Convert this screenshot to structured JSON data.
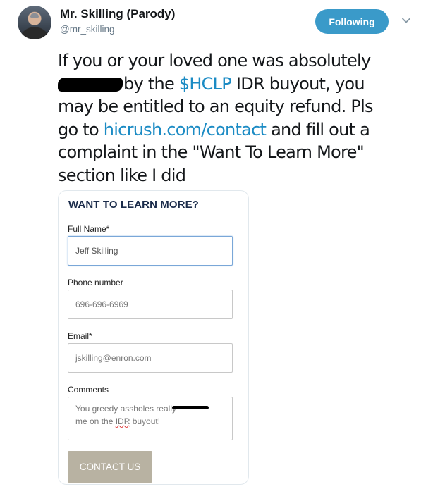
{
  "tweet": {
    "display_name": "Mr. Skilling (Parody)",
    "handle": "@mr_skilling",
    "follow_button": "Following",
    "text": {
      "line1": "If you or your loved one was absolutely",
      "line2_after_redaction": "by the ",
      "line2_cashtag": "$HCLP",
      "line2_end": " IDR buyout, you",
      "line3": "may be entitled to an equity refund. Pls",
      "line4_start": "go to ",
      "line4_link": "hicrush.com/contact",
      "line4_end": " and fill out a",
      "line5": "complaint in the \"Want To Learn More\"",
      "line6": "section like I did"
    },
    "icons": [
      "avatar",
      "chevron-down-icon",
      "redaction-mark"
    ]
  },
  "form": {
    "title": "WANT TO LEARN MORE?",
    "full_name_label": "Full Name*",
    "full_name_value": "Jeff Skilling",
    "phone_label": "Phone number",
    "phone_value": "696-696-6969",
    "email_label": "Email*",
    "email_value": "jskilling@enron.com",
    "comments_label": "Comments",
    "comments_line1": "You greedy assholes really",
    "comments_line2_start": "me on the ",
    "comments_line2_idr": "IDR",
    "comments_line2_end": " buyout!",
    "submit_label": "CONTACT US"
  },
  "colors": {
    "follow_button": "#3a9ac9",
    "link": "#1b8bc4",
    "submit_button": "#b8b2a2",
    "form_title": "#1a2b4a"
  }
}
